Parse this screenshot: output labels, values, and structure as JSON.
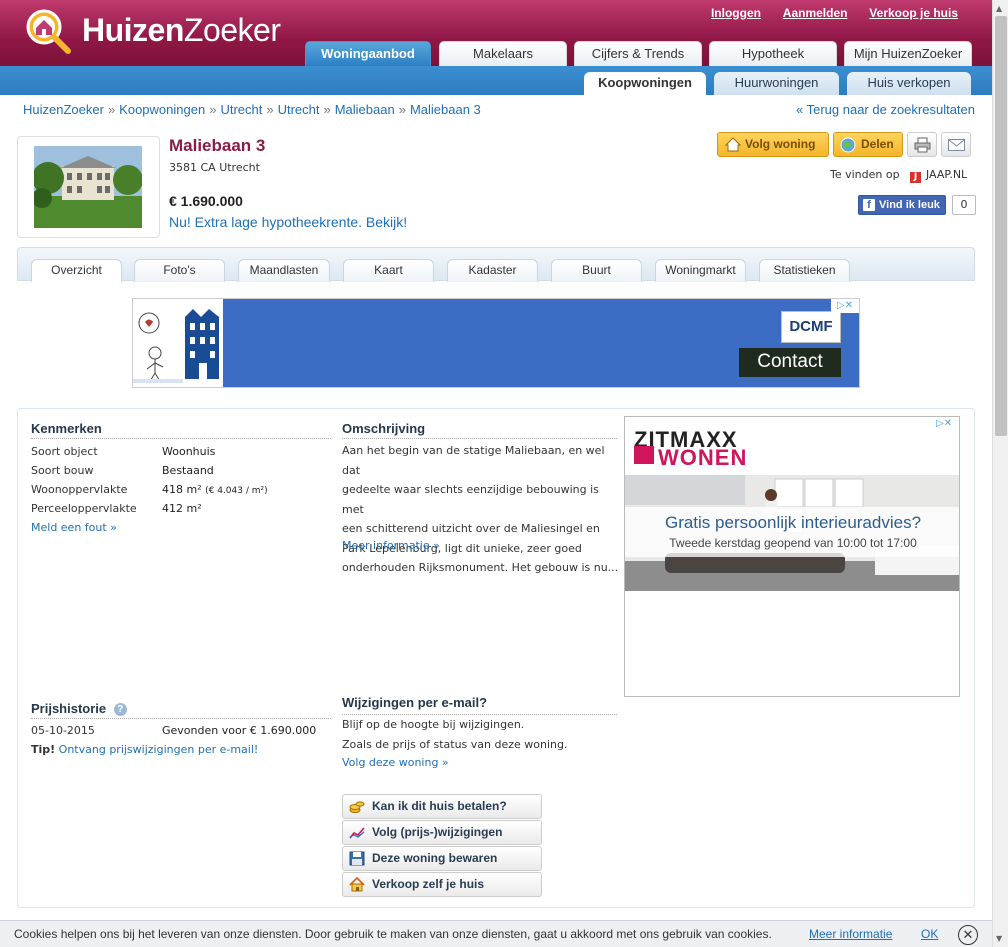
{
  "brand": {
    "part1": "Huizen",
    "part2": "Zoeker"
  },
  "top_links": [
    "Inloggen",
    "Aanmelden",
    "Verkoop je huis"
  ],
  "main_tabs": [
    "Woningaanbod",
    "Makelaars",
    "Cijfers & Trends",
    "Hypotheek",
    "Mijn HuizenZoeker"
  ],
  "sub_tabs": [
    "Koopwoningen",
    "Huurwoningen",
    "Huis verkopen"
  ],
  "breadcrumb": [
    "HuizenZoeker",
    "Koopwoningen",
    "Utrecht",
    "Utrecht",
    "Maliebaan",
    "Maliebaan 3"
  ],
  "breadcrumb_sep": "»",
  "back_link": "« Terug naar de zoekresultaten",
  "listing": {
    "title": "Maliebaan 3",
    "postal": "3581 CA Utrecht",
    "price": "€ 1.690.000",
    "promo": "Nu! Extra lage hypotheekrente. Bekijk!"
  },
  "actions": {
    "follow": "Volg woning",
    "share": "Delen",
    "print_icon": "printer-icon",
    "mail_icon": "envelope-icon"
  },
  "found_on": {
    "label": "Te vinden op",
    "source": "JAAP.NL"
  },
  "facebook": {
    "label": "Vind ik leuk",
    "count": "0"
  },
  "page_tabs": [
    "Overzicht",
    "Foto's",
    "Maandlasten",
    "Kaart",
    "Kadaster",
    "Buurt",
    "Woningmarkt",
    "Statistieken"
  ],
  "banner_ad": {
    "logo": "DCMF",
    "button": "Contact"
  },
  "kenmerken": {
    "heading": "Kenmerken",
    "rows": [
      {
        "label": "Soort object",
        "value": "Woonhuis"
      },
      {
        "label": "Soort bouw",
        "value": "Bestaand"
      },
      {
        "label": "Woonoppervlakte",
        "value": "418 m²",
        "extra": "(€ 4.043 / m²)"
      },
      {
        "label": "Perceeloppervlakte",
        "value": "412 m²"
      }
    ],
    "report_link": "Meld een fout »"
  },
  "omschrijving": {
    "heading": "Omschrijving",
    "lines": [
      "Aan het begin van de statige Maliebaan, en wel dat",
      "gedeelte waar slechts eenzijdige bebouwing is met",
      "een schitterend uitzicht over de Maliesingel en",
      "Park Lepelenburg, ligt dit unieke, zeer goed",
      "onderhouden Rijksmonument. Het gebouw is nu..."
    ],
    "more_link": "Meer informatie »"
  },
  "ad2": {
    "brand_top": "ZITMAXX",
    "brand_bottom": "WONEN",
    "headline": "Gratis persoonlijk interieuradvies?",
    "subline": "Tweede kerstdag geopend van 10:00 tot 17:00"
  },
  "prijshistorie": {
    "heading": "Prijshistorie",
    "rows": [
      {
        "date": "05-10-2015",
        "event": "Gevonden voor € 1.690.000"
      }
    ],
    "tip_label": "Tip!",
    "tip_link": "Ontvang prijswijzigingen per e-mail!"
  },
  "wijzigingen": {
    "heading": "Wijzigingen per e-mail?",
    "lines": [
      "Blijf op de hoogte bij wijzigingen.",
      "Zoals de prijs of status van deze woning."
    ],
    "link": "Volg deze woning »"
  },
  "action_buttons": [
    {
      "label": "Kan ik dit huis betalen?",
      "icon": "coins-icon"
    },
    {
      "label": "Volg (prijs-)wijzigingen",
      "icon": "chart-icon"
    },
    {
      "label": "Deze woning bewaren",
      "icon": "floppy-icon"
    },
    {
      "label": "Verkoop zelf je huis",
      "icon": "house-icon"
    }
  ],
  "cookie": {
    "text": "Cookies helpen ons bij het leveren van onze diensten. Door gebruik te maken van onze diensten, gaat u akkoord met ons gebruik van cookies.",
    "more": "Meer informatie",
    "ok": "OK"
  },
  "colors": {
    "brand": "#8f1746",
    "nav_blue": "#2d7cc0",
    "link": "#1e6fb5",
    "button_yellow": "#f4b52a"
  }
}
